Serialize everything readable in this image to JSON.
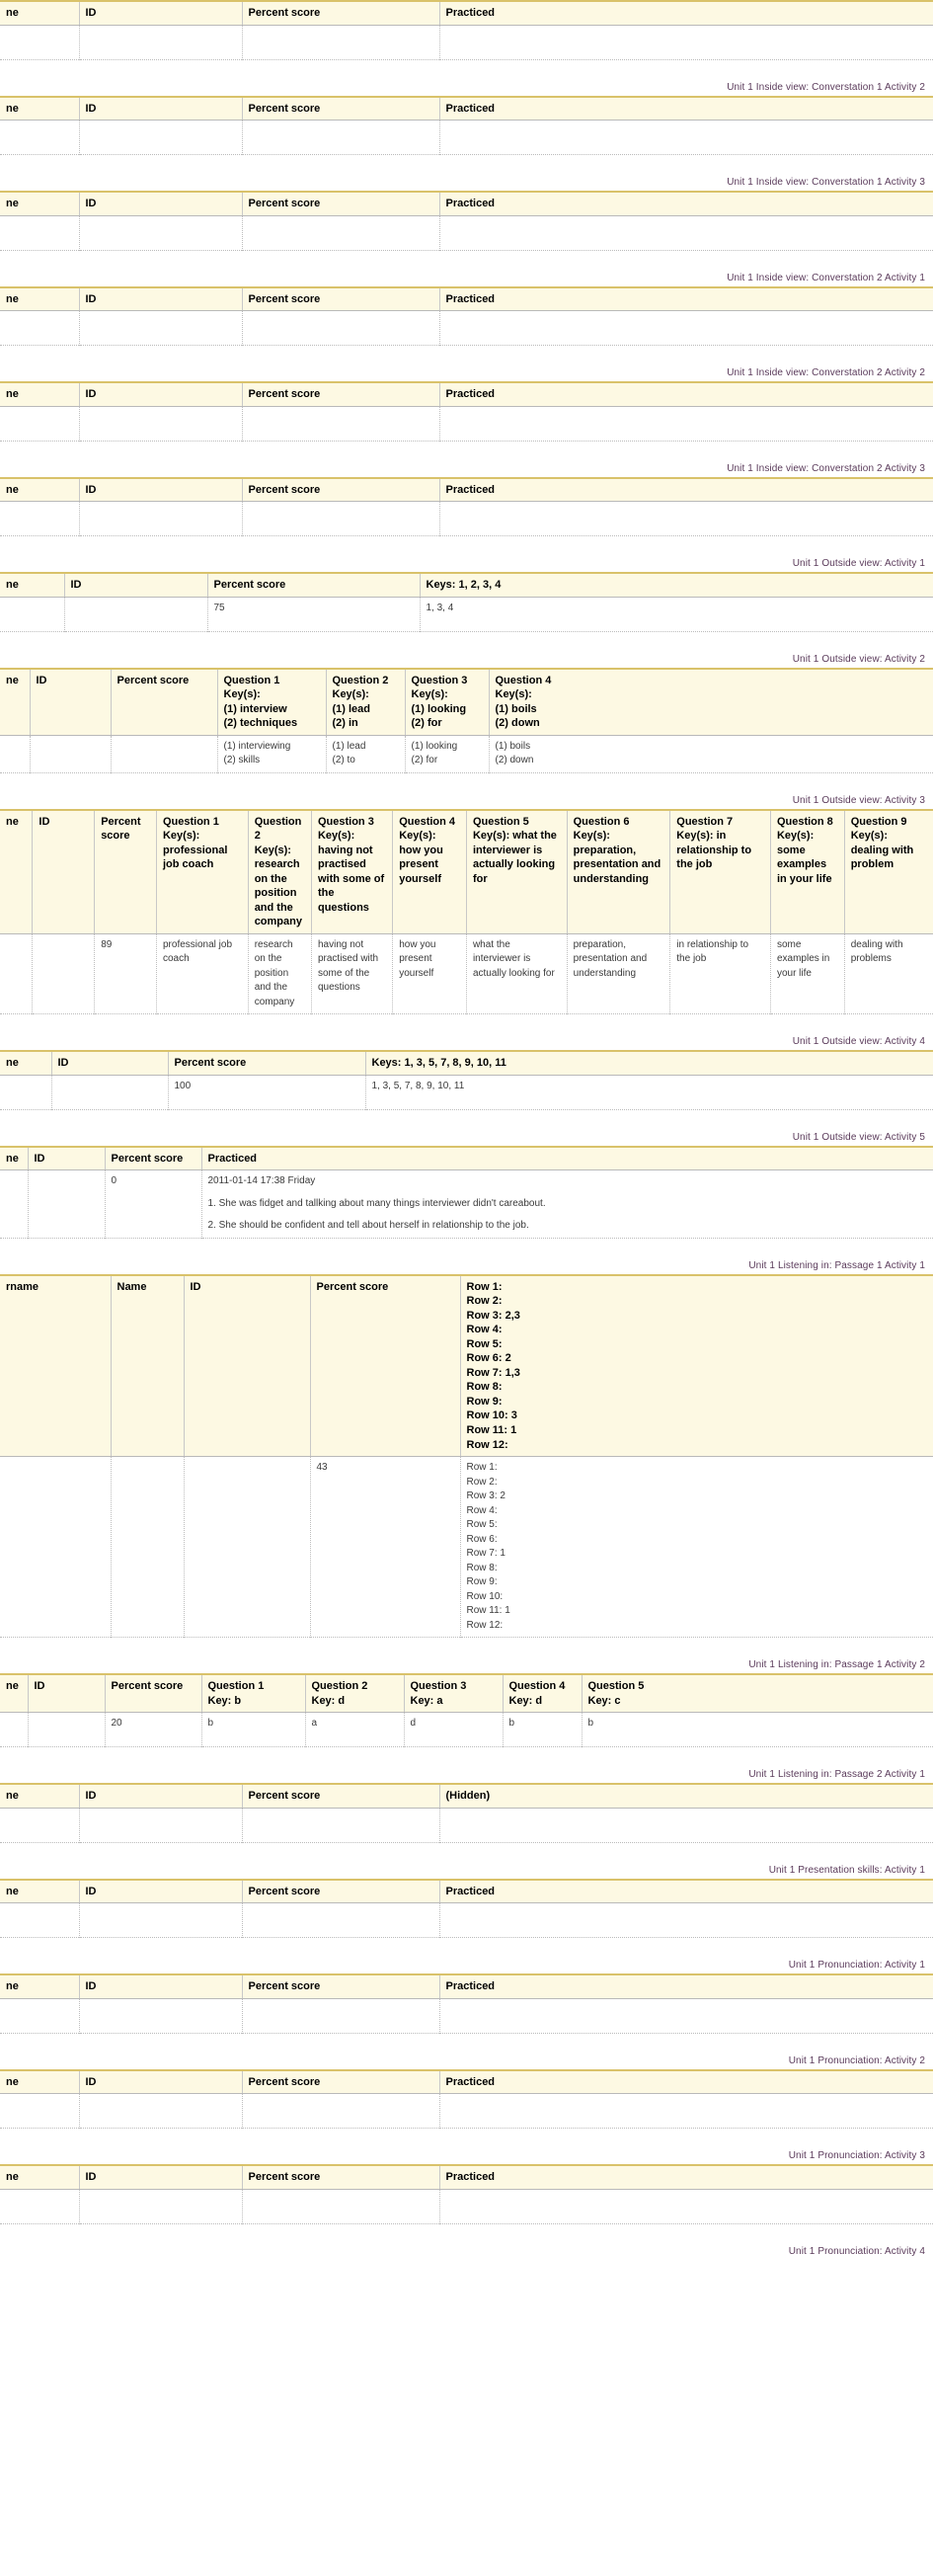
{
  "common": {
    "col_name": "ne",
    "col_id": "ID",
    "col_percent": "Percent score",
    "col_practiced": "Practiced",
    "col_hidden": "(Hidden)",
    "col_keys_label": "Keys: 1, 2, 3, 4",
    "empty": ""
  },
  "sections": [
    {
      "caption": "",
      "type": "basic",
      "headers": [
        "ne",
        "ID",
        "Percent score",
        "Practiced"
      ],
      "rows": [
        [
          "",
          "",
          "",
          ""
        ]
      ]
    },
    {
      "caption": "Unit 1 Inside view: Converstation 1 Activity 2",
      "type": "basic",
      "headers": [
        "ne",
        "ID",
        "Percent score",
        "Practiced"
      ],
      "rows": [
        [
          "",
          "",
          "",
          ""
        ]
      ]
    },
    {
      "caption": "Unit 1 Inside view: Converstation 1 Activity 3",
      "type": "basic",
      "headers": [
        "ne",
        "ID",
        "Percent score",
        "Practiced"
      ],
      "rows": [
        [
          "",
          "",
          "",
          ""
        ]
      ]
    },
    {
      "caption": "Unit 1 Inside view: Converstation 2 Activity 1",
      "type": "basic",
      "headers": [
        "ne",
        "ID",
        "Percent score",
        "Practiced"
      ],
      "rows": [
        [
          "",
          "",
          "",
          ""
        ]
      ]
    },
    {
      "caption": "Unit 1 Inside view: Converstation 2 Activity 2",
      "type": "basic",
      "headers": [
        "ne",
        "ID",
        "Percent score",
        "Practiced"
      ],
      "rows": [
        [
          "",
          "",
          "",
          ""
        ]
      ]
    },
    {
      "caption": "Unit 1 Inside view: Converstation 2 Activity 3",
      "type": "basic",
      "headers": [
        "ne",
        "ID",
        "Percent score",
        "Practiced"
      ],
      "rows": [
        [
          "",
          "",
          "",
          ""
        ]
      ]
    },
    {
      "caption": "Unit 1 Outside view: Activity 1",
      "type": "ov1",
      "headers": [
        "ne",
        "ID",
        "Percent score",
        "Keys: 1, 2, 3, 4"
      ],
      "rows": [
        [
          "",
          "",
          "75",
          "1, 3, 4"
        ]
      ]
    },
    {
      "caption": "Unit 1 Outside view: Activity 2",
      "type": "ov2",
      "headers": [
        "ne",
        "ID",
        "Percent score",
        "Question 1\nKey(s):\n(1) interview\n(2) techniques",
        "Question 2\nKey(s):\n(1) lead\n(2) in",
        "Question 3\nKey(s):\n(1) looking\n(2) for",
        "Question 4\nKey(s):\n(1) boils\n(2) down"
      ],
      "header_parts": [
        [
          "Question 1",
          "Key(s):",
          "(1) interview",
          "(2) techniques"
        ],
        [
          "Question 2",
          "Key(s):",
          "(1) lead",
          "(2) in"
        ],
        [
          "Question 3",
          "Key(s):",
          "(1) looking",
          "(2) for"
        ],
        [
          "Question 4",
          "Key(s):",
          "(1) boils",
          "(2) down"
        ]
      ],
      "rows": [
        [
          "",
          "",
          "",
          "(1) interviewing\n(2) skills",
          "(1) lead\n(2) to",
          "(1) looking\n(2) for",
          "(1) boils\n(2) down"
        ]
      ],
      "row_parts": [
        [
          "(1) interviewing",
          "(2) skills"
        ],
        [
          "(1) lead",
          "(2) to"
        ],
        [
          "(1) looking",
          "(2) for"
        ],
        [
          "(1) boils",
          "(2) down"
        ]
      ]
    },
    {
      "caption": "Unit 1 Outside view: Activity 3",
      "type": "ov3",
      "headers": [
        "ne",
        "ID",
        "Percent score",
        "Question 1\nKey(s): professional job coach",
        "Question 2\nKey(s): research on the position and the company",
        "Question 3\nKey(s): having not practised with some of the questions",
        "Question 4\nKey(s): how you present yourself",
        "Question 5\nKey(s): what the interviewer is actually looking for",
        "Question 6\nKey(s): preparation, presentation and understanding",
        "Question 7\nKey(s): in relationship to the job",
        "Question 8\nKey(s): some examples in your life",
        "Question 9\nKey(s): dealing with problem"
      ],
      "header_parts": [
        [
          "Question 1",
          "Key(s): professional job coach"
        ],
        [
          "Question 2",
          "Key(s): research on the position and the company"
        ],
        [
          "Question 3",
          "Key(s): having not practised with some of the questions"
        ],
        [
          "Question 4",
          "Key(s): how you present yourself"
        ],
        [
          "Question 5",
          "Key(s): what the interviewer is actually looking for"
        ],
        [
          "Question 6",
          "Key(s): preparation, presentation and understanding"
        ],
        [
          "Question 7",
          "Key(s): in relationship to the job"
        ],
        [
          "Question 8",
          "Key(s): some examples in your life"
        ],
        [
          "Question 9",
          "Key(s): dealing with problem"
        ]
      ],
      "rows": [
        [
          "",
          "",
          "89",
          "professional job coach",
          "research on the position and the company",
          "having not practised with some of the questions",
          "how you present yourself",
          "what the interviewer is actually looking for",
          "preparation, presentation and understanding",
          "in relationship to the job",
          "some examples in your life",
          "dealing with problems"
        ]
      ]
    },
    {
      "caption": "Unit 1 Outside view: Activity 4",
      "type": "ov4",
      "headers": [
        "ne",
        "ID",
        "Percent score",
        "Keys: 1, 3, 5, 7, 8, 9, 10, 11"
      ],
      "rows": [
        [
          "",
          "",
          "100",
          "1, 3, 5, 7, 8, 9, 10, 11"
        ]
      ]
    },
    {
      "caption": "Unit 1 Outside view: Activity 5",
      "type": "ov5",
      "headers": [
        "ne",
        "ID",
        "Percent score",
        "Practiced"
      ],
      "rows": [
        [
          "",
          "",
          "0",
          "2011-01-14 17:38 Friday|1. She was fidget and tallking about many things interviewer didn't careabout.|2. She should be confident and tell about herself in relationship to the job."
        ]
      ],
      "practiced_lines": [
        "2011-01-14 17:38 Friday",
        "1. She was fidget and tallking about many things interviewer didn't careabout.",
        "2. She should be confident and tell about herself in relationship to the job."
      ]
    },
    {
      "caption": "Unit 1 Listening in: Passage 1 Activity 1",
      "type": "li1",
      "headers": [
        "rname",
        "Name",
        "ID",
        "Percent score",
        "rows-key-block"
      ],
      "header_rows": [
        "Row 1:",
        "Row 2:",
        "Row 3: 2,3",
        "Row 4:",
        "Row 5:",
        "Row 6: 2",
        "Row 7: 1,3",
        "Row 8:",
        "Row 9:",
        "Row 10: 3",
        "Row 11: 1",
        "Row 12:"
      ],
      "rows": [
        [
          "",
          "",
          "",
          "43",
          ""
        ]
      ],
      "body_rows": [
        "Row 1:",
        "Row 2:",
        "Row 3: 2",
        "Row 4:",
        "Row 5:",
        "Row 6:",
        "Row 7: 1",
        "Row 8:",
        "Row 9:",
        "Row 10:",
        "Row 11: 1",
        "Row 12:"
      ]
    },
    {
      "caption": "Unit 1 Listening in: Passage 1 Activity 2",
      "type": "li2",
      "headers": [
        "ne",
        "ID",
        "Percent score",
        "Question 1\nKey: b",
        "Question 2\nKey: d",
        "Question 3\nKey: a",
        "Question 4\nKey: d",
        "Question 5\nKey: c"
      ],
      "header_parts": [
        [
          "Question 1",
          "Key: b"
        ],
        [
          "Question 2",
          "Key: d"
        ],
        [
          "Question 3",
          "Key: a"
        ],
        [
          "Question 4",
          "Key: d"
        ],
        [
          "Question 5",
          "Key: c"
        ]
      ],
      "rows": [
        [
          "",
          "",
          "20",
          "b",
          "a",
          "d",
          "b",
          "b"
        ]
      ]
    },
    {
      "caption": "Unit 1 Listening in: Passage 2 Activity 1",
      "type": "hidden",
      "headers": [
        "ne",
        "ID",
        "Percent score",
        "(Hidden)"
      ],
      "rows": [
        [
          "",
          "",
          "",
          ""
        ]
      ]
    },
    {
      "caption": "Unit 1 Presentation skills: Activity 1",
      "type": "basic",
      "headers": [
        "ne",
        "ID",
        "Percent score",
        "Practiced"
      ],
      "rows": [
        [
          "",
          "",
          "",
          ""
        ]
      ]
    },
    {
      "caption": "Unit 1 Pronunciation: Activity 1",
      "type": "basic",
      "headers": [
        "ne",
        "ID",
        "Percent score",
        "Practiced"
      ],
      "rows": [
        [
          "",
          "",
          "",
          ""
        ]
      ]
    },
    {
      "caption": "Unit 1 Pronunciation: Activity 2",
      "type": "basic",
      "headers": [
        "ne",
        "ID",
        "Percent score",
        "Practiced"
      ],
      "rows": [
        [
          "",
          "",
          "",
          ""
        ]
      ]
    },
    {
      "caption": "Unit 1 Pronunciation: Activity 3",
      "type": "basic",
      "headers": [
        "ne",
        "ID",
        "Percent score",
        "Practiced"
      ],
      "rows": [
        [
          "",
          "",
          "",
          ""
        ]
      ]
    },
    {
      "caption": "Unit 1 Pronunciation: Activity 4",
      "type": "trailing",
      "headers": [],
      "rows": []
    }
  ]
}
